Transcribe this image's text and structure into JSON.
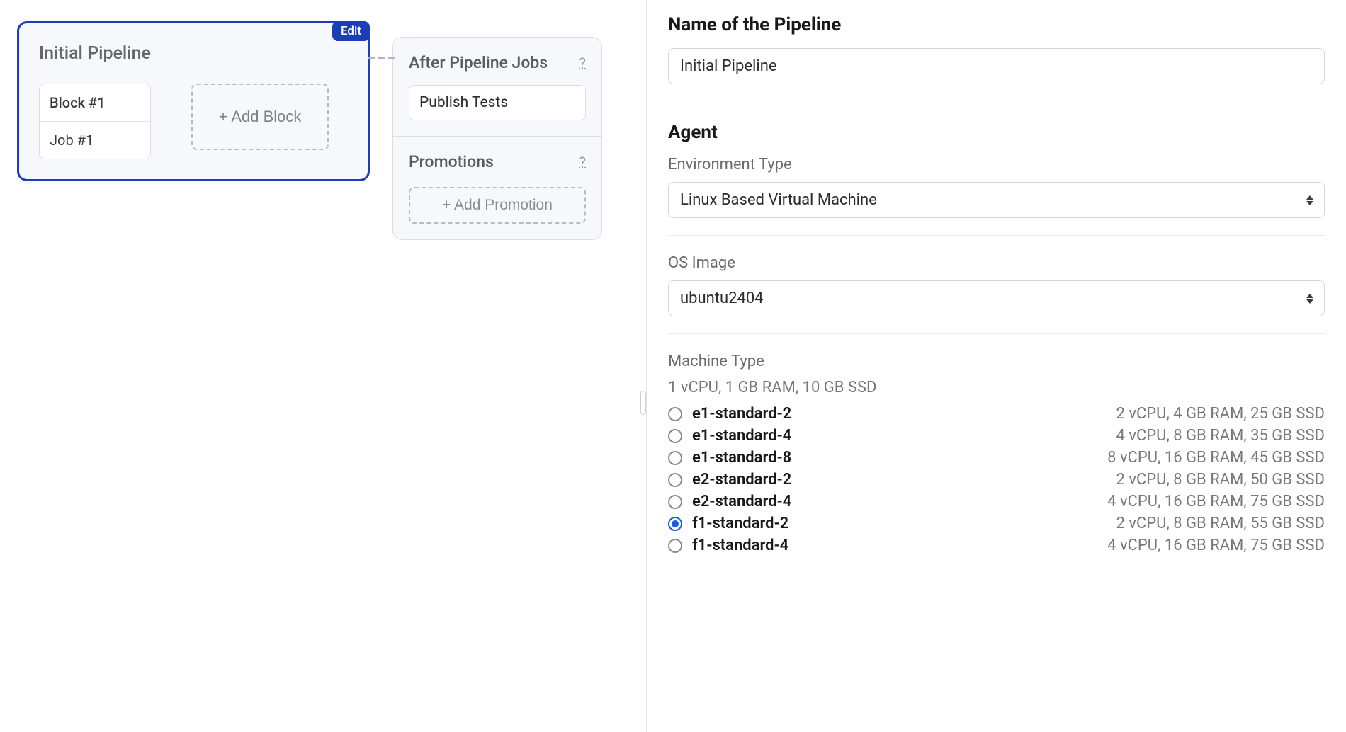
{
  "pipeline": {
    "title": "Initial Pipeline",
    "edit_label": "Edit",
    "block": {
      "header": "Block #1",
      "job": "Job #1"
    },
    "add_block_label": "+ Add Block"
  },
  "after_jobs": {
    "title": "After Pipeline Jobs",
    "help": "?",
    "items": [
      "Publish Tests"
    ]
  },
  "promotions": {
    "title": "Promotions",
    "help": "?",
    "add_label": "+ Add Promotion"
  },
  "form": {
    "name_label": "Name of the Pipeline",
    "name_value": "Initial Pipeline",
    "agent_heading": "Agent",
    "env_label": "Environment Type",
    "env_value": "Linux Based Virtual Machine",
    "os_label": "OS Image",
    "os_value": "ubuntu2404",
    "machine_label": "Machine Type",
    "machine_summary": "1 vCPU, 1 GB RAM, 10 GB SSD",
    "machine_types": [
      {
        "name": "e1-standard-2",
        "spec": "2 vCPU, 4 GB RAM, 25 GB SSD",
        "checked": false
      },
      {
        "name": "e1-standard-4",
        "spec": "4 vCPU, 8 GB RAM, 35 GB SSD",
        "checked": false
      },
      {
        "name": "e1-standard-8",
        "spec": "8 vCPU, 16 GB RAM, 45 GB SSD",
        "checked": false
      },
      {
        "name": "e2-standard-2",
        "spec": "2 vCPU, 8 GB RAM, 50 GB SSD",
        "checked": false
      },
      {
        "name": "e2-standard-4",
        "spec": "4 vCPU, 16 GB RAM, 75 GB SSD",
        "checked": false
      },
      {
        "name": "f1-standard-2",
        "spec": "2 vCPU, 8 GB RAM, 55 GB SSD",
        "checked": true
      },
      {
        "name": "f1-standard-4",
        "spec": "4 vCPU, 16 GB RAM, 75 GB SSD",
        "checked": false
      }
    ]
  }
}
